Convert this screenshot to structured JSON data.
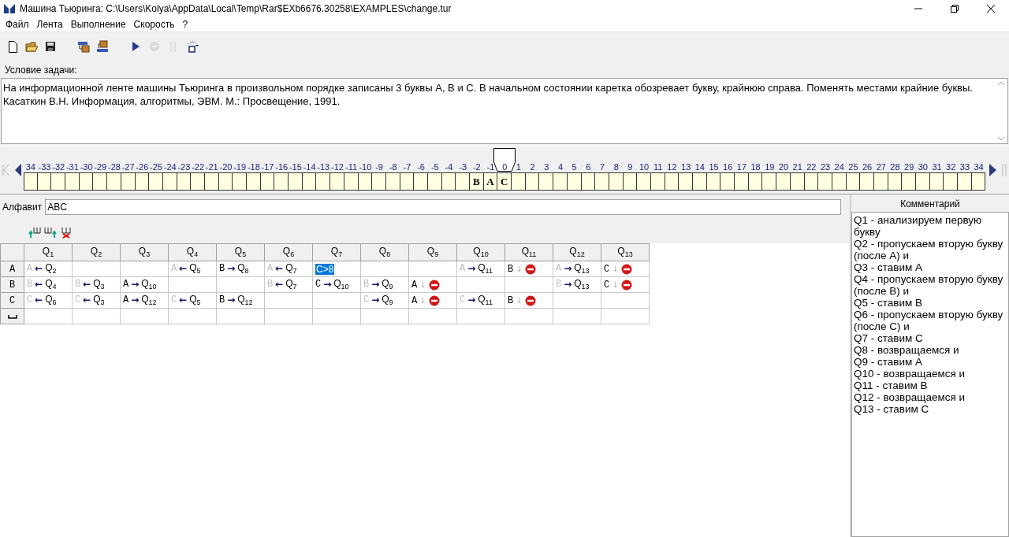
{
  "window": {
    "title": "Машина Тьюринга: C:\\Users\\Kolya\\AppData\\Local\\Temp\\Rar$EXb6676.30258\\EXAMPLES\\change.tur"
  },
  "menu": [
    "Файл",
    "Лента",
    "Выполнение",
    "Скорость",
    "?"
  ],
  "toolbar": [
    {
      "disabled": false
    },
    {
      "disabled": false
    },
    {
      "disabled": false
    },
    {
      "disabled": false
    },
    {
      "disabled": false
    },
    {
      "disabled": false
    },
    {
      "disabled": true
    },
    {
      "disabled": true
    },
    {
      "disabled": false
    }
  ],
  "condition": {
    "label": "Условие задачи:",
    "lines": [
      "На информационной ленте машины Тьюринга в произвольном порядке записаны 3 буквы A, B и C. В начальном состоянии каретка обозревает букву, крайнюю справа. Поменять местами крайние буквы.",
      "Касаткин В.Н. Информация, алгоритмы, ЭВМ. М.: Просвещение, 1991."
    ]
  },
  "tape": {
    "cells": [
      {
        "label": "34"
      },
      {
        "label": "-33"
      },
      {
        "label": "-32"
      },
      {
        "label": "-31"
      },
      {
        "label": "-30"
      },
      {
        "label": "-29"
      },
      {
        "label": "-28"
      },
      {
        "label": "-27"
      },
      {
        "label": "-26"
      },
      {
        "label": "-25"
      },
      {
        "label": "-24"
      },
      {
        "label": "-23"
      },
      {
        "label": "-22"
      },
      {
        "label": "-21"
      },
      {
        "label": "-20"
      },
      {
        "label": "-19"
      },
      {
        "label": "-18"
      },
      {
        "label": "-17"
      },
      {
        "label": "-16"
      },
      {
        "label": "-15"
      },
      {
        "label": "-14"
      },
      {
        "label": "-13"
      },
      {
        "label": "-12"
      },
      {
        "label": "-11"
      },
      {
        "label": "-10"
      },
      {
        "label": "-9"
      },
      {
        "label": "-8"
      },
      {
        "label": "-7"
      },
      {
        "label": "-6"
      },
      {
        "label": "-5"
      },
      {
        "label": "-4"
      },
      {
        "label": "-3"
      },
      {
        "label": "-2",
        "symbol": "B"
      },
      {
        "label": "-1",
        "symbol": "A"
      },
      {
        "label": "0",
        "symbol": "C",
        "head": true
      },
      {
        "label": "1"
      },
      {
        "label": "2"
      },
      {
        "label": "3"
      },
      {
        "label": "4"
      },
      {
        "label": "5"
      },
      {
        "label": "6"
      },
      {
        "label": "7"
      },
      {
        "label": "8"
      },
      {
        "label": "9"
      },
      {
        "label": "10"
      },
      {
        "label": "11"
      },
      {
        "label": "12"
      },
      {
        "label": "13"
      },
      {
        "label": "14"
      },
      {
        "label": "15"
      },
      {
        "label": "16"
      },
      {
        "label": "17"
      },
      {
        "label": "18"
      },
      {
        "label": "19"
      },
      {
        "label": "20"
      },
      {
        "label": "21"
      },
      {
        "label": "22"
      },
      {
        "label": "23"
      },
      {
        "label": "24"
      },
      {
        "label": "25"
      },
      {
        "label": "26"
      },
      {
        "label": "27"
      },
      {
        "label": "28"
      },
      {
        "label": "29"
      },
      {
        "label": "30"
      },
      {
        "label": "31"
      },
      {
        "label": "32"
      },
      {
        "label": "33"
      },
      {
        "label": "34"
      }
    ]
  },
  "alphabet": {
    "label": "Алфавит",
    "value": "ABC"
  },
  "table": {
    "columns": [
      "Q$_{1}$",
      "Q$_{2}$",
      "Q$_{3}$",
      "Q$_{4}$",
      "Q$_{5}$",
      "Q$_{6}$",
      "Q$_{7}$",
      "Q$_{8}$",
      "Q$_{9}$",
      "Q$_{10}$",
      "Q$_{11}$",
      "Q$_{12}$",
      "Q$_{13}$"
    ],
    "rows": [
      {
        "kind": "letter",
        "symbol": "A",
        "cells": [
          {
            "kind": "rule",
            "symbol": "A",
            "dim": true,
            "move": "←",
            "next": "Q$_{2}$"
          },
          {
            "kind": "empty"
          },
          {
            "kind": "empty"
          },
          {
            "kind": "rule",
            "symbol": "A",
            "dim": true,
            "move": "←",
            "next": "Q$_{5}$"
          },
          {
            "kind": "rule",
            "symbol": "B",
            "dim": false,
            "move": "→",
            "next": "Q$_{8}$"
          },
          {
            "kind": "rule",
            "symbol": "A",
            "dim": true,
            "move": "←",
            "next": "Q$_{7}$"
          },
          {
            "kind": "edit",
            "value": "C>8",
            "selected": true
          },
          {
            "kind": "empty"
          },
          {
            "kind": "empty"
          },
          {
            "kind": "rule",
            "symbol": "A",
            "dim": true,
            "move": "→",
            "next": "Q$_{11}$"
          },
          {
            "kind": "rule",
            "symbol": "B",
            "dim": false,
            "move": "↓",
            "halt": true
          },
          {
            "kind": "rule",
            "symbol": "A",
            "dim": true,
            "move": "→",
            "next": "Q$_{13}$"
          },
          {
            "kind": "rule",
            "symbol": "C",
            "dim": false,
            "move": "↓",
            "halt": true
          }
        ]
      },
      {
        "kind": "letter",
        "symbol": "B",
        "cells": [
          {
            "kind": "rule",
            "symbol": "B",
            "dim": true,
            "move": "←",
            "next": "Q$_{4}$"
          },
          {
            "kind": "rule",
            "symbol": "B",
            "dim": true,
            "move": "←",
            "next": "Q$_{3}$"
          },
          {
            "kind": "rule",
            "symbol": "A",
            "dim": false,
            "move": "→",
            "next": "Q$_{10}$"
          },
          {
            "kind": "empty"
          },
          {
            "kind": "empty"
          },
          {
            "kind": "rule",
            "symbol": "B",
            "dim": true,
            "move": "←",
            "next": "Q$_{7}$"
          },
          {
            "kind": "rule",
            "symbol": "C",
            "dim": false,
            "move": "→",
            "next": "Q$_{10}$"
          },
          {
            "kind": "rule",
            "symbol": "B",
            "dim": true,
            "move": "→",
            "next": "Q$_{9}$"
          },
          {
            "kind": "rule",
            "symbol": "A",
            "dim": false,
            "move": "↓",
            "halt": true
          },
          {
            "kind": "empty"
          },
          {
            "kind": "empty"
          },
          {
            "kind": "rule",
            "symbol": "B",
            "dim": true,
            "move": "→",
            "next": "Q$_{13}$"
          },
          {
            "kind": "rule",
            "symbol": "C",
            "dim": false,
            "move": "↓",
            "halt": true
          }
        ]
      },
      {
        "kind": "letter",
        "symbol": "C",
        "cells": [
          {
            "kind": "rule",
            "symbol": "C",
            "dim": true,
            "move": "←",
            "next": "Q$_{6}$"
          },
          {
            "kind": "rule",
            "symbol": "C",
            "dim": true,
            "move": "←",
            "next": "Q$_{3}$"
          },
          {
            "kind": "rule",
            "symbol": "A",
            "dim": false,
            "move": "→",
            "next": "Q$_{12}$"
          },
          {
            "kind": "rule",
            "symbol": "C",
            "dim": true,
            "move": "←",
            "next": "Q$_{5}$"
          },
          {
            "kind": "rule",
            "symbol": "B",
            "dim": false,
            "move": "→",
            "next": "Q$_{12}$"
          },
          {
            "kind": "empty"
          },
          {
            "kind": "empty"
          },
          {
            "kind": "rule",
            "symbol": "C",
            "dim": true,
            "move": "→",
            "next": "Q$_{9}$"
          },
          {
            "kind": "rule",
            "symbol": "A",
            "dim": false,
            "move": "↓",
            "halt": true
          },
          {
            "kind": "rule",
            "symbol": "C",
            "dim": true,
            "move": "→",
            "next": "Q$_{11}$"
          },
          {
            "kind": "rule",
            "symbol": "B",
            "dim": false,
            "move": "↓",
            "halt": true
          },
          {
            "kind": "empty"
          },
          {
            "kind": "empty"
          }
        ]
      },
      {
        "kind": "blank",
        "cells": [
          {
            "kind": "empty"
          },
          {
            "kind": "empty"
          },
          {
            "kind": "empty"
          },
          {
            "kind": "empty"
          },
          {
            "kind": "empty"
          },
          {
            "kind": "empty"
          },
          {
            "kind": "empty"
          },
          {
            "kind": "empty"
          },
          {
            "kind": "empty"
          },
          {
            "kind": "empty"
          },
          {
            "kind": "empty"
          },
          {
            "kind": "empty"
          },
          {
            "kind": "empty"
          }
        ]
      }
    ]
  },
  "comments": {
    "title": "Комментарий",
    "lines": [
      "Q1 - анализируем первую букву",
      "Q2 - пропускаем вторую букву (после A) и",
      "Q3 - ставим A",
      "Q4 - пропускаем вторую букву (после B) и",
      "Q5 - ставим B",
      "Q6 - пропускаем вторую букву (после C) и",
      "Q7 - ставим C",
      "Q8 - возвращаемся и",
      "Q9 - ставим A",
      "Q10 - возвращаемся и",
      "Q11 - ставим B",
      "Q12 - возвращаемся и",
      "Q13 - ставим C"
    ]
  }
}
